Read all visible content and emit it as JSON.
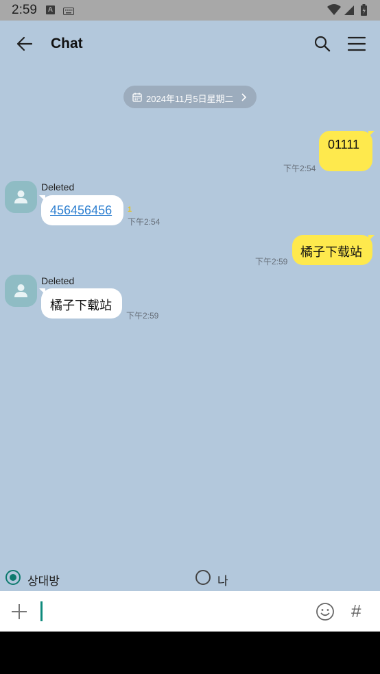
{
  "status_bar": {
    "time": "2:59",
    "icons": [
      "a-notification-icon",
      "keyboard-icon",
      "wifi-icon",
      "signal-icon",
      "battery-icon"
    ]
  },
  "app_bar": {
    "title": "Chat",
    "icons": [
      "back-arrow-icon",
      "search-icon",
      "menu-icon"
    ]
  },
  "date_chip": {
    "text": "2024年11月5日星期二",
    "icons": [
      "calendar-icon",
      "chevron-right-icon"
    ]
  },
  "messages": [
    {
      "from": "me",
      "text": "01111",
      "time": "下午2:54"
    },
    {
      "from": "other",
      "sender": "Deleted",
      "text": "456456456",
      "is_link": true,
      "unread": "1",
      "time": "下午2:54"
    },
    {
      "from": "me",
      "text": "橘子下载站",
      "time": "下午2:59"
    },
    {
      "from": "other",
      "sender": "Deleted",
      "text": "橘子下载站",
      "time": "下午2:59"
    }
  ],
  "sender_toggle": {
    "options": [
      {
        "label": "상대방",
        "selected": true
      },
      {
        "label": "나",
        "selected": false
      }
    ]
  },
  "input_bar": {
    "value": "",
    "placeholder": "",
    "icons": [
      "plus-icon",
      "emoji-icon",
      "hashtag-icon"
    ],
    "hash_glyph": "#"
  },
  "colors": {
    "chat_background": "#b3c8dc",
    "my_bubble": "#fee94d",
    "other_bubble": "#ffffff",
    "accent": "#0e7a6e",
    "link": "#2d7fd0"
  }
}
